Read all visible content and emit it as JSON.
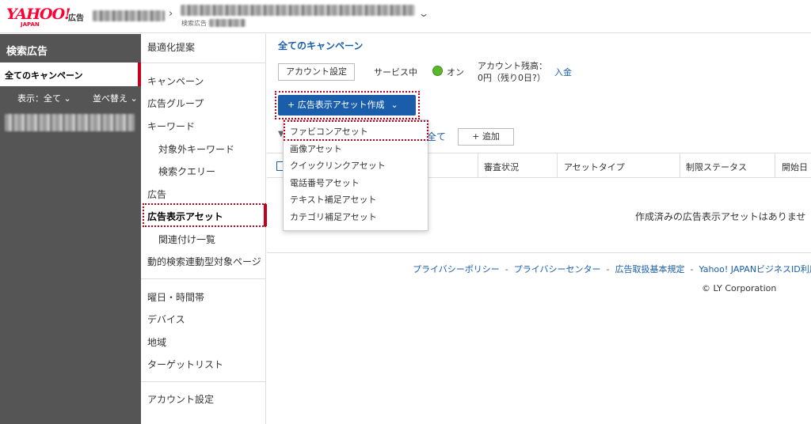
{
  "header": {
    "logo_text": "YAHOO!",
    "logo_sub": "JAPAN",
    "logo_ad": "広告",
    "breadcrumb_sub": "検索広告"
  },
  "sidebar": {
    "title": "検索広告",
    "active_item": "全てのキャンペーン",
    "filter_display": "表示：全て",
    "filter_sort": "並べ替え"
  },
  "nav": {
    "items": [
      "最適化提案",
      "キャンペーン",
      "広告グループ",
      "キーワード",
      "対象外キーワード",
      "検索クエリー",
      "広告",
      "広告表示アセット",
      "関連付け一覧",
      "動的検索連動型対象ページ",
      "曜日・時間帯",
      "デバイス",
      "地域",
      "ターゲットリスト",
      "アカウント設定"
    ]
  },
  "main": {
    "title": "全てのキャンペーン",
    "account_settings_btn": "アカウント設定",
    "service_label": "サービス中",
    "status_text": "オン",
    "balance_label": "アカウント残高：",
    "balance_value": "0円（残り0日?）",
    "deposit_link": "入金",
    "create_btn": "+ 広告表示アセット作成",
    "filter_all": "全て",
    "add_btn": "+ 追加",
    "columns": [
      "審査状況",
      "アセットタイプ",
      "制限ステータス",
      "開始日"
    ],
    "empty_message": "作成済みの広告表示アセットはありませ"
  },
  "dropdown": {
    "items": [
      "ファビコンアセット",
      "画像アセット",
      "クイックリンクアセット",
      "電話番号アセット",
      "テキスト補足アセット",
      "カテゴリ補足アセット"
    ]
  },
  "footer": {
    "links": [
      "プライバシーポリシー",
      "プライバシーセンター",
      "広告取扱基本規定",
      "Yahoo! JAPANビジネスID利用"
    ],
    "separator": "-",
    "copyright": "© LY Corporation"
  },
  "colors": {
    "accent_red": "#c4001a",
    "link_blue": "#1a5eab",
    "status_green": "#5cb82a",
    "sidebar_dark": "#555555"
  }
}
